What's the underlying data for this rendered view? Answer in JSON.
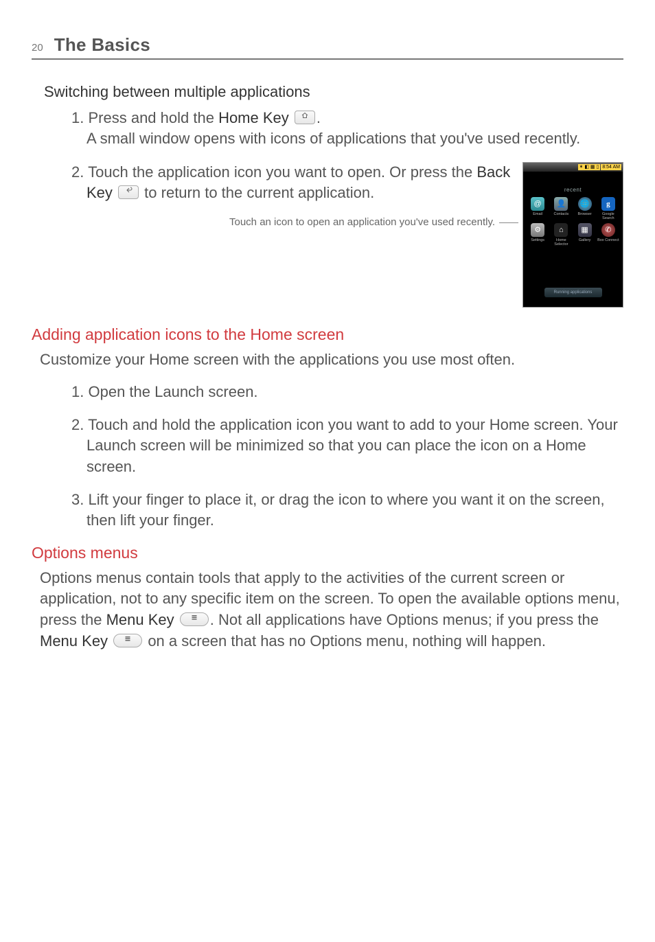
{
  "header": {
    "page_number": "20",
    "title": "The Basics"
  },
  "section_switching": {
    "heading": "Switching between multiple applications",
    "step1_num": "1.",
    "step1_a": "Press and hold the ",
    "step1_home_key": "Home Key",
    "step1_b": ".",
    "step1_c": "A small window opens with icons of applications that you've used recently.",
    "step2_num": "2.",
    "step2_a": "Touch the application icon you want to open. Or press the ",
    "step2_back_key": "Back Key",
    "step2_b": " to return to the current application.",
    "caption": "Touch an icon to open an application you've used recently."
  },
  "phone": {
    "time": "8:54 AM",
    "recent_label": "recent",
    "bottom_button": "Running applications",
    "apps": [
      {
        "label": "Email"
      },
      {
        "label": "Contacts"
      },
      {
        "label": "Browser"
      },
      {
        "label": "Google Search"
      },
      {
        "label": "Settings"
      },
      {
        "label": "Home Selector"
      },
      {
        "label": "Gallery"
      },
      {
        "label": "Box Connect"
      }
    ]
  },
  "section_adding": {
    "heading": "Adding application icons to the Home screen",
    "intro": "Customize your Home screen with the applications you use most often.",
    "step1_num": "1.",
    "step1": "Open the Launch screen.",
    "step2_num": "2.",
    "step2": "Touch and hold the application icon you want to add to your Home screen. Your Launch screen will be minimized so that you can place the icon on a Home screen.",
    "step3_num": "3.",
    "step3": "Lift your finger to place it, or drag the icon to where you want it on the screen, then lift your finger."
  },
  "section_options": {
    "heading": "Options menus",
    "body_a": "Options menus contain tools that apply to the activities of the current screen or application, not to any specific item on the screen. To open the available options menu, press the ",
    "menu_key": "Menu Key",
    "body_b": ". Not all applications have Options menus; if you press the ",
    "body_c": " on a screen that has no Options menu, nothing will happen."
  }
}
